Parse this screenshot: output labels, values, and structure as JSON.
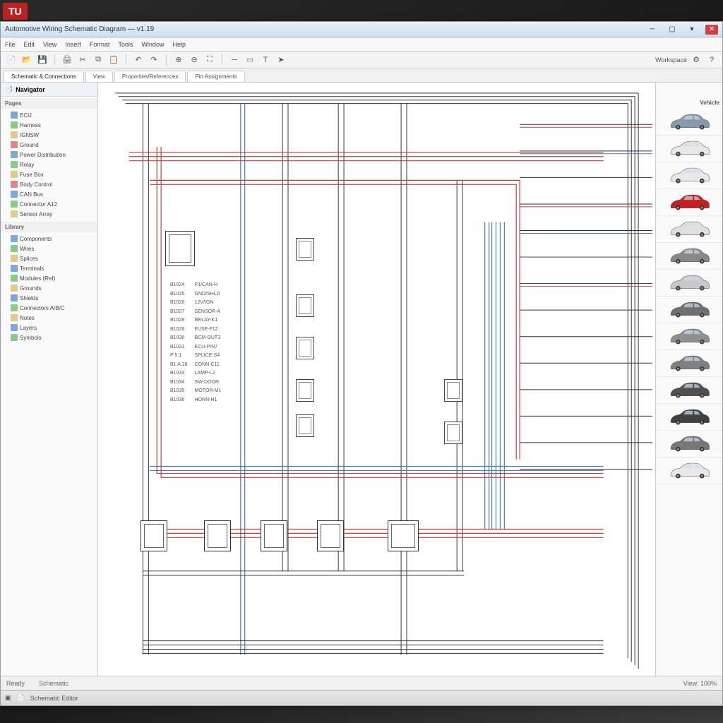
{
  "app_badge": "TU",
  "titlebar": {
    "title": "Automotive Wiring Schematic Diagram — v1.19"
  },
  "menubar": [
    "File",
    "Edit",
    "View",
    "Insert",
    "Format",
    "Tools",
    "Window",
    "Help"
  ],
  "toolbar": {
    "labels": [
      "New",
      "Open",
      "Save",
      "Print",
      "Export"
    ],
    "right_label": "Workspace"
  },
  "tabs": [
    "Schematic & Connections",
    "View",
    "Properties/References",
    "Pin Assignments"
  ],
  "sidebar": {
    "header": "Navigator",
    "section1": "Pages",
    "items1": [
      "ECU",
      "Harness",
      "IGNSW",
      "Ground",
      "Power Distribution",
      "Relay",
      "Fuse Box",
      "Body Control",
      "CAN Bus",
      "Connector A12",
      "Sensor Array"
    ],
    "section2": "Library",
    "items2": [
      "Components",
      "Wires",
      "Splices",
      "Terminals",
      "Modules (Ref)",
      "Grounds",
      "Shields",
      "Connectors A/B/C",
      "Notes",
      "Layers",
      "Symbols"
    ]
  },
  "diagram_table": {
    "col1": [
      "B1024",
      "B1025",
      "B1026",
      "B1027",
      "B1028",
      "B1029",
      "B1030",
      "B1031",
      "P 5.1",
      "B1 A.18",
      "B1033",
      "B1034",
      "B1035",
      "B1036"
    ],
    "col2": [
      "P1/CAN-H",
      "GND/SHLD",
      "12V/IGN",
      "SENSOR-A",
      "RELAY-K1",
      "FUSE-F12",
      "BCM-OUT3",
      "ECU-PIN7",
      "SPLICE-S4",
      "CONN-C11",
      "LAMP-L2",
      "SW-DOOR",
      "MOTOR-M1",
      "HORN-H1"
    ]
  },
  "right_panel": {
    "header": "Vehicle",
    "vehicles": [
      {
        "color": "#8899aa"
      },
      {
        "color": "#e8e8e8"
      },
      {
        "color": "#e8e8e8"
      },
      {
        "color": "#c02020"
      },
      {
        "color": "#e0e0e0"
      },
      {
        "color": "#888888"
      },
      {
        "color": "#c8c8c8"
      },
      {
        "color": "#707070"
      },
      {
        "color": "#909090"
      },
      {
        "color": "#808080"
      },
      {
        "color": "#505050"
      },
      {
        "color": "#404040"
      },
      {
        "color": "#787878"
      },
      {
        "color": "#e8e8e8"
      }
    ]
  },
  "statusbar": {
    "left": "Ready",
    "mid": "Schematic",
    "right": "View: 100%"
  },
  "taskbar": {
    "item": "Schematic Editor"
  }
}
